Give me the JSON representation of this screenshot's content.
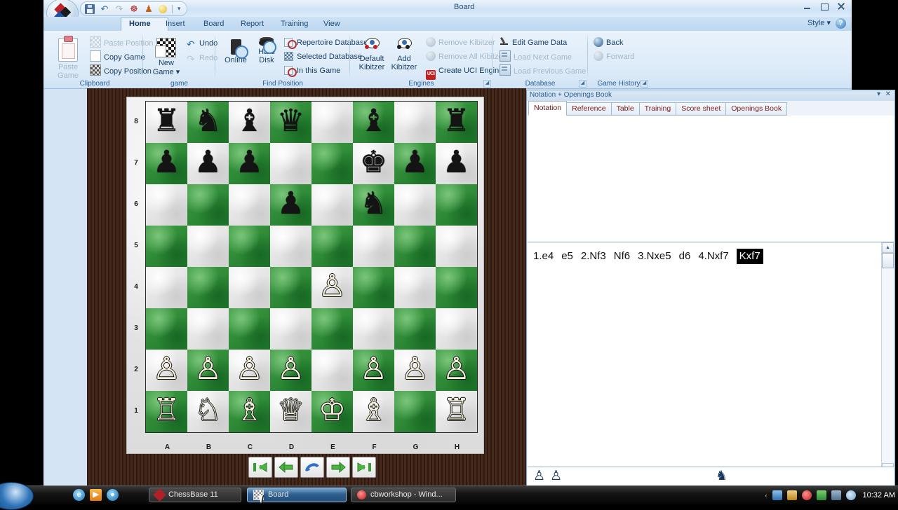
{
  "window": {
    "title": "Board",
    "style_label": "Style",
    "help_label": "?",
    "controls": {
      "minimize": "–",
      "maximize": "□",
      "close": "×"
    }
  },
  "quick_access": {
    "items": [
      "save-icon",
      "undo-icon",
      "redo-icon",
      "engine-icon",
      "person-icon",
      "bulb-icon",
      "more-icon"
    ]
  },
  "ribbon": {
    "tabs": [
      {
        "label": "Home",
        "active": true
      },
      {
        "label": "Insert",
        "active": false
      },
      {
        "label": "Board",
        "active": false
      },
      {
        "label": "Report",
        "active": false
      },
      {
        "label": "Training",
        "active": false
      },
      {
        "label": "View",
        "active": false
      }
    ],
    "groups": [
      {
        "label": "Clipboard",
        "big": [
          {
            "label": "Paste\nGame",
            "line1": "Paste",
            "line2": "Game",
            "disabled": true
          }
        ],
        "items": [
          {
            "label": "Paste Position",
            "disabled": true
          },
          {
            "label": "Copy Game",
            "disabled": false
          },
          {
            "label": "Copy Position",
            "disabled": false
          }
        ]
      },
      {
        "label": "game",
        "big": [
          {
            "line1": "New",
            "line2": "Game ▾",
            "disabled": false
          }
        ],
        "items": [
          {
            "label": "Undo",
            "disabled": false
          },
          {
            "label": "Redo",
            "disabled": true
          }
        ]
      },
      {
        "label": "Find Position",
        "big": [
          {
            "line1": "Online",
            "line2": "",
            "disabled": false
          },
          {
            "line1": "Hard",
            "line2": "Disk",
            "disabled": false
          }
        ],
        "items": [
          {
            "label": "Repertoire Database",
            "disabled": false
          },
          {
            "label": "Selected Database",
            "disabled": false
          },
          {
            "label": "In this Game",
            "disabled": false
          }
        ]
      },
      {
        "label": "Engines",
        "big": [
          {
            "line1": "Default",
            "line2": "Kibitzer",
            "disabled": false
          },
          {
            "line1": "Add",
            "line2": "Kibitzer",
            "disabled": false
          }
        ],
        "items": [
          {
            "label": "Remove Kibitzer",
            "disabled": true
          },
          {
            "label": "Remove All Kibitzers",
            "disabled": true
          },
          {
            "label": "Create UCI Engine",
            "disabled": false
          }
        ]
      },
      {
        "label": "Database",
        "big": [],
        "items": [
          {
            "label": "Edit Game Data",
            "disabled": false
          },
          {
            "label": "Load Next Game",
            "disabled": true
          },
          {
            "label": "Load Previous Game",
            "disabled": true
          }
        ]
      },
      {
        "label": "Game History",
        "big": [],
        "items": [
          {
            "label": "Back",
            "disabled": false
          },
          {
            "label": "Forward",
            "disabled": true
          }
        ]
      }
    ]
  },
  "board": {
    "files": [
      "A",
      "B",
      "C",
      "D",
      "E",
      "F",
      "G",
      "H"
    ],
    "ranks": [
      "8",
      "7",
      "6",
      "5",
      "4",
      "3",
      "2",
      "1"
    ],
    "position": [
      [
        "r",
        "n",
        "b",
        "q",
        "",
        "b",
        "",
        "r"
      ],
      [
        "p",
        "p",
        "p",
        "",
        "",
        "k",
        "p",
        "p"
      ],
      [
        "",
        "",
        "",
        "p",
        "",
        "n",
        "",
        ""
      ],
      [
        "",
        "",
        "",
        "",
        "",
        "",
        "",
        ""
      ],
      [
        "",
        "",
        "",
        "",
        "P",
        "",
        "",
        ""
      ],
      [
        "",
        "",
        "",
        "",
        "",
        "",
        "",
        ""
      ],
      [
        "P",
        "P",
        "P",
        "P",
        "",
        "P",
        "P",
        "P"
      ],
      [
        "R",
        "N",
        "B",
        "Q",
        "K",
        "B",
        "",
        "R"
      ]
    ],
    "nav_buttons": [
      {
        "name": "go-to-start-button",
        "glyph": "first"
      },
      {
        "name": "step-back-button",
        "glyph": "back"
      },
      {
        "name": "flip-board-button",
        "glyph": "curve"
      },
      {
        "name": "step-forward-button",
        "glyph": "forward"
      },
      {
        "name": "go-to-end-button",
        "glyph": "last"
      }
    ]
  },
  "notation": {
    "panel_title": "Notation + Openings Book",
    "tabs": [
      {
        "label": "Notation",
        "active": true
      },
      {
        "label": "Reference",
        "active": false
      },
      {
        "label": "Table",
        "active": false
      },
      {
        "label": "Training",
        "active": false
      },
      {
        "label": "Score sheet",
        "active": false
      },
      {
        "label": "Openings Book",
        "active": false
      }
    ],
    "moves": [
      {
        "text": "1.e4",
        "selected": false
      },
      {
        "text": "e5",
        "selected": false
      },
      {
        "text": "2.Nf3",
        "selected": false
      },
      {
        "text": "Nf6",
        "selected": false
      },
      {
        "text": "3.Nxe5",
        "selected": false
      },
      {
        "text": "d6",
        "selected": false
      },
      {
        "text": "4.Nxf7",
        "selected": false
      },
      {
        "text": "Kxf7",
        "selected": true
      }
    ],
    "material": {
      "white_captured": [
        "♙",
        "♙"
      ],
      "black_captured": [
        "♞"
      ]
    }
  },
  "taskbar": {
    "buttons": [
      {
        "label": "ChessBase 11",
        "icon": "chessbase-icon",
        "active": false
      },
      {
        "label": "Board",
        "icon": "board-icon",
        "active": true
      },
      {
        "label": "cbworkshop - Wind...",
        "icon": "opera-icon",
        "active": false
      }
    ],
    "clock": "10:32 AM",
    "tray_chevron": "‹"
  },
  "colors": {
    "dark_square": "#2f8a38",
    "light_square": "#e6e6e6",
    "ribbon_blue": "#d4e4f5",
    "accent_text": "#17375e",
    "selection_bg": "#000000",
    "wood_border": "#3d2114"
  }
}
